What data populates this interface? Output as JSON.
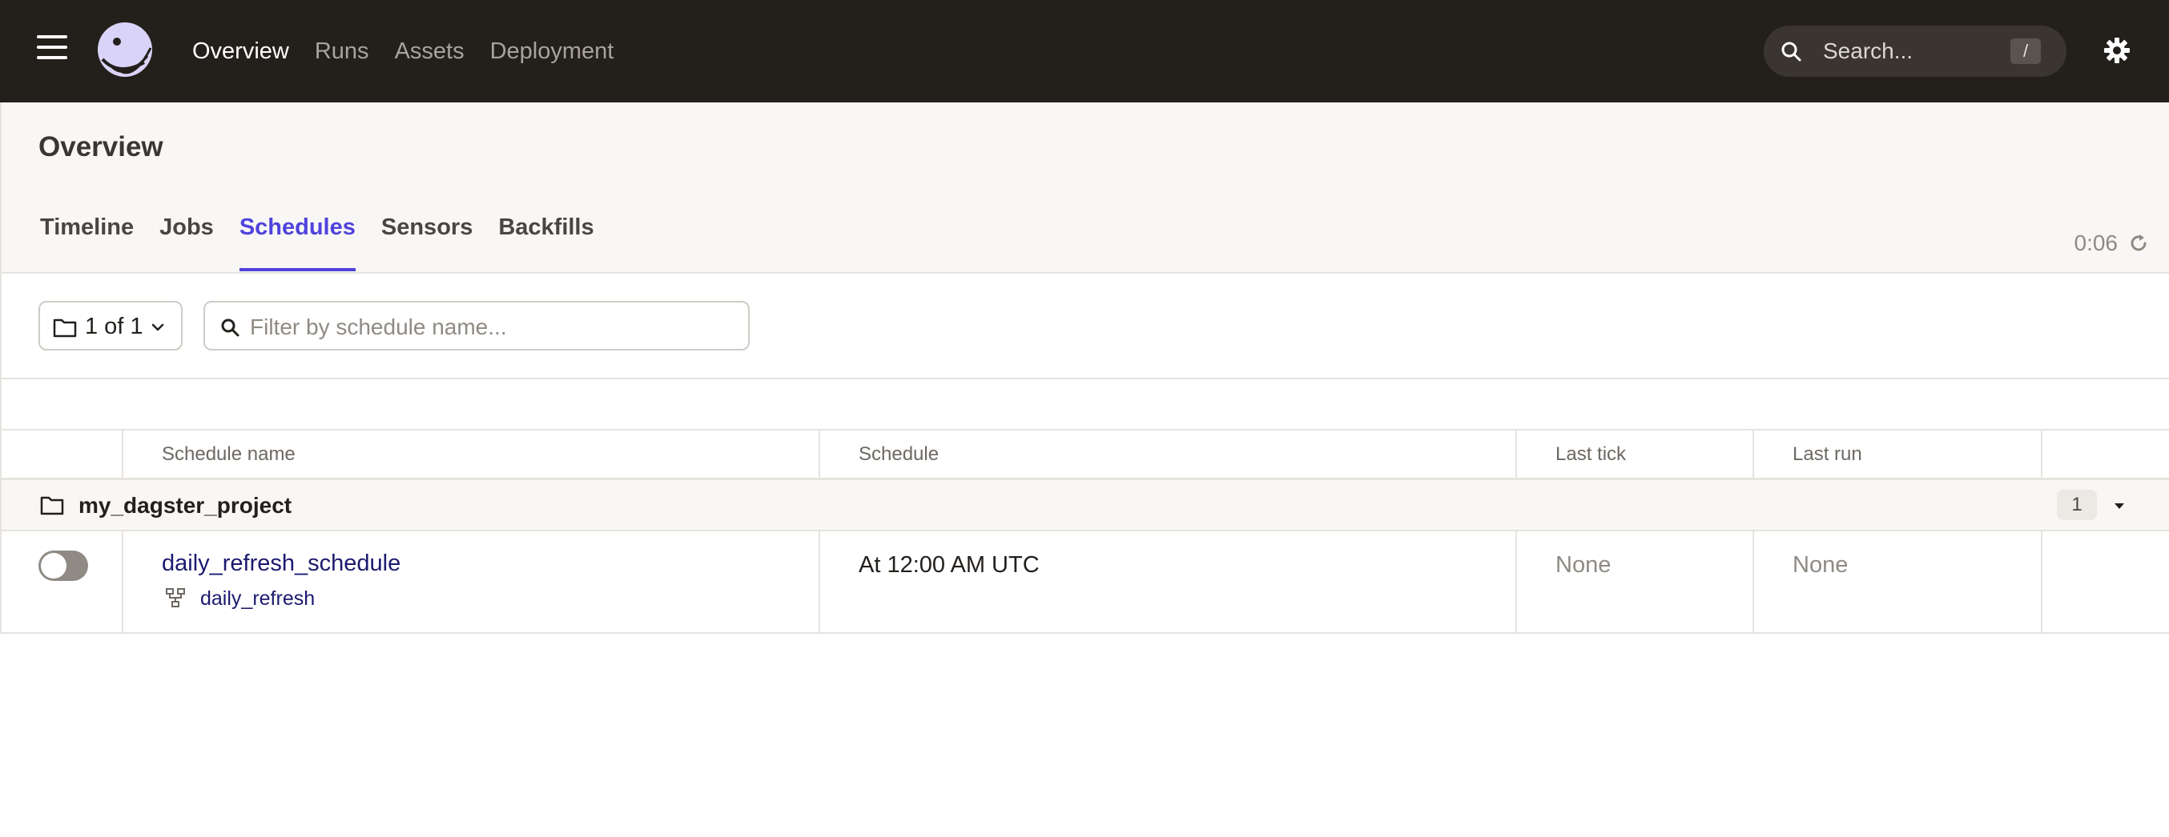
{
  "topbar": {
    "nav": [
      "Overview",
      "Runs",
      "Assets",
      "Deployment"
    ],
    "active_nav": "Overview",
    "search_placeholder": "Search...",
    "search_shortcut": "/"
  },
  "header": {
    "title": "Overview",
    "tabs": [
      "Timeline",
      "Jobs",
      "Schedules",
      "Sensors",
      "Backfills"
    ],
    "active_tab": "Schedules",
    "refresh_time": "0:06"
  },
  "filters": {
    "repo_selector": "1 of 1",
    "schedule_filter_placeholder": "Filter by schedule name..."
  },
  "table": {
    "columns": [
      "Schedule name",
      "Schedule",
      "Last tick",
      "Last run"
    ],
    "groups": [
      {
        "name": "my_dagster_project",
        "count": "1",
        "rows": [
          {
            "schedule_name": "daily_refresh_schedule",
            "job": "daily_refresh",
            "schedule": "At 12:00 AM UTC",
            "last_tick": "None",
            "last_run": "None",
            "enabled": false
          }
        ]
      }
    ]
  },
  "colors": {
    "topbar_bg": "#231f1b",
    "accent": "#4f43dd",
    "link": "#1c1a6f"
  }
}
